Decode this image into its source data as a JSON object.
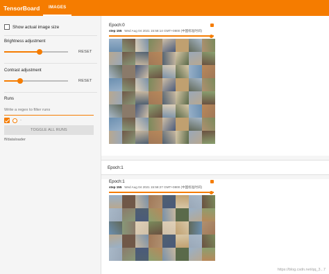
{
  "app": {
    "title": "TensorBoard",
    "tabs": [
      {
        "label": "IMAGES",
        "active": true
      }
    ]
  },
  "sidebar": {
    "show_actual_size": {
      "label": "Show actual image size",
      "checked": false
    },
    "brightness": {
      "label": "Brightness adjustment",
      "value": 0.55,
      "reset": "RESET"
    },
    "contrast": {
      "label": "Contrast adjustment",
      "value": 0.25,
      "reset": "RESET"
    },
    "runs": {
      "heading": "Runs",
      "filter_placeholder": "Write a regex to filter runs",
      "run_selected": true,
      "run_label": "-",
      "toggle_label": "TOGGLE ALL RUNS",
      "path": "ff/dataloader"
    }
  },
  "main": {
    "cards": [
      {
        "title": "Epoch:0",
        "step_label": "step",
        "step": "155",
        "timestamp": "Wed Aug 04 2021 15:58:14 GMT+0800 (中国标准时间)"
      },
      {
        "title": "Epoch:1",
        "step_label": "step",
        "step": "155",
        "timestamp": "Wed Aug 04 2021 15:58:27 GMT+0800 (中国标准时间)"
      }
    ],
    "section_title": "Epoch:1"
  },
  "colors": {
    "accent": "#f57c00",
    "tiles": [
      "#7a8a5c",
      "#c8b8a0",
      "#8a7a6a",
      "#6b8fb0",
      "#b09070",
      "#9aa8b8",
      "#5a6a4a",
      "#d0c0a8",
      "#a07858",
      "#4a5a7a",
      "#889878",
      "#b8a890",
      "#6a5040",
      "#98b0c8",
      "#c0a070",
      "#506070",
      "#8aa070",
      "#e0d0b8",
      "#705848",
      "#a8b8c8",
      "#b8885a",
      "#606858",
      "#d8c8a8",
      "#7890a8"
    ]
  },
  "watermark": "https://blog.csdn.net/qq_3...7"
}
